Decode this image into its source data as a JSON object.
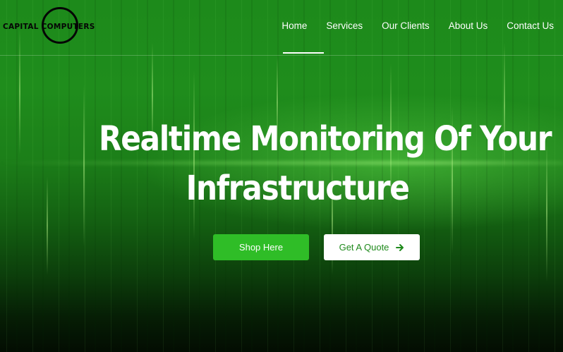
{
  "brand": {
    "logo_text": "CAPITAL COMPUTERS"
  },
  "nav": {
    "items": [
      {
        "label": "Home",
        "active": true
      },
      {
        "label": "Services"
      },
      {
        "label": "Our Clients"
      },
      {
        "label": "About Us"
      },
      {
        "label": "Contact Us"
      }
    ]
  },
  "hero": {
    "headline_line1": "Realtime Monitoring Of Your",
    "headline_line2": "Infrastructure",
    "shop_button": "Shop Here",
    "quote_button": "Get A Quote",
    "quote_icon": "arrow-right-icon"
  },
  "colors": {
    "background_green": "#1f8d1c",
    "primary_button": "#2fbd27",
    "text_white": "#ffffff"
  }
}
